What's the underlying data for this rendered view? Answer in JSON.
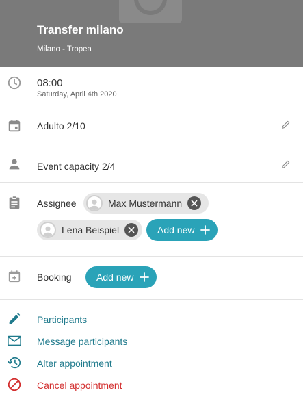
{
  "header": {
    "title": "Transfer milano",
    "subtitle": "Milano - Tropea",
    "background_color": "#7a7a7a"
  },
  "time": {
    "value": "08:00",
    "date": "Saturday, April 4th 2020",
    "icon": "clock-icon"
  },
  "ticket": {
    "label": "Adulto 2/10",
    "icon": "calendar-icon"
  },
  "capacity": {
    "label": "Event capacity 2/4",
    "icon": "person-icon"
  },
  "assignee": {
    "label": "Assignee",
    "icon": "clipboard-icon",
    "people": [
      {
        "name": "Max Mustermann"
      },
      {
        "name": "Lena Beispiel"
      }
    ],
    "add_label": "Add new"
  },
  "booking": {
    "label": "Booking",
    "icon": "calendar-plus-icon",
    "add_label": "Add new"
  },
  "actions": [
    {
      "label": "Participants",
      "icon": "pencil-icon",
      "color": "#1f7a8c"
    },
    {
      "label": "Message participants",
      "icon": "mail-icon",
      "color": "#1f7a8c"
    },
    {
      "label": "Alter appointment",
      "icon": "history-icon",
      "color": "#1f7a8c"
    },
    {
      "label": "Cancel appointment",
      "icon": "cancel-icon",
      "color": "#d32f2f"
    }
  ],
  "colors": {
    "accent": "#2aa3b8",
    "link": "#1f7a8c",
    "danger": "#d32f2f"
  }
}
